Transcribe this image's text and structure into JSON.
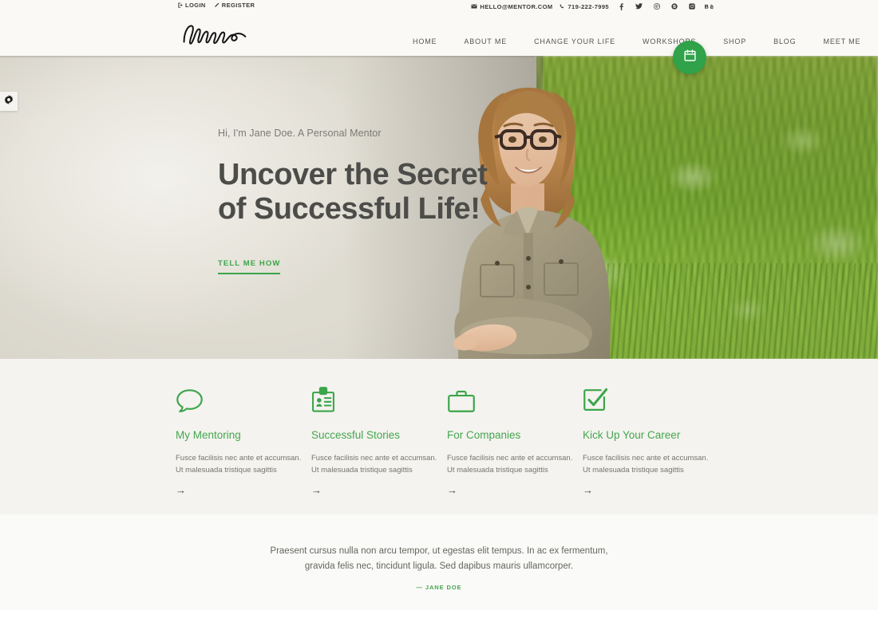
{
  "topbar": {
    "left_links": [
      {
        "label": "LOGIN",
        "icon": "login-icon"
      },
      {
        "label": "REGISTER",
        "icon": "pencil-icon"
      }
    ],
    "email": "HELLO@MENTOR.COM",
    "phone": "719-222-7995",
    "email_icon": "envelope-icon",
    "phone_icon": "phone-icon",
    "social": [
      {
        "name": "facebook-icon"
      },
      {
        "name": "twitter-icon"
      },
      {
        "name": "pinterest-icon"
      },
      {
        "name": "skype-icon"
      },
      {
        "name": "instagram-icon"
      },
      {
        "name": "behance-icon"
      }
    ]
  },
  "header": {
    "logo_text": "Mentor",
    "nav": [
      {
        "label": "HOME"
      },
      {
        "label": "ABOUT ME"
      },
      {
        "label": "CHANGE YOUR LIFE"
      },
      {
        "label": "WORKSHOPS"
      },
      {
        "label": "SHOP"
      },
      {
        "label": "BLOG"
      },
      {
        "label": "MEET ME"
      }
    ]
  },
  "hero": {
    "subtitle": "Hi, I'm Jane Doe. A Personal Mentor",
    "title": "Uncover the Secret\nof Successful Life!",
    "cta_label": "TELL ME HOW",
    "gear_icon": "gear-icon",
    "calendar_icon": "calendar-icon"
  },
  "features": [
    {
      "icon": "speech-bubble-icon",
      "title": "My Mentoring",
      "text": "Fusce facilisis nec ante et accumsan.\nUt malesuada tristique sagittis",
      "arrow": "→"
    },
    {
      "icon": "id-badge-icon",
      "title": "Successful Stories",
      "text": "Fusce facilisis nec ante et accumsan.\nUt malesuada tristique sagittis",
      "arrow": "→"
    },
    {
      "icon": "briefcase-icon",
      "title": "For Companies",
      "text": "Fusce facilisis nec ante et accumsan.\nUt malesuada tristique sagittis",
      "arrow": "→"
    },
    {
      "icon": "checkbox-check-icon",
      "title": "Kick Up Your Career",
      "text": "Fusce facilisis nec ante et accumsan.\nUt malesuada tristique sagittis",
      "arrow": "→"
    }
  ],
  "quote": {
    "text": "Praesent cursus nulla non arcu tempor, ut egestas elit tempus. In ac ex fermentum, gravida felis nec, tincidunt ligula. Sed dapibus mauris ullamcorper.",
    "author": "— JANE DOE"
  },
  "colors": {
    "accent_green": "#3aa54a",
    "header_bg": "#faf9f6",
    "features_bg": "#f4f3ef",
    "quote_bg": "#fafaf8",
    "text_dark": "#4c4c49",
    "text_muted": "#76756f"
  }
}
